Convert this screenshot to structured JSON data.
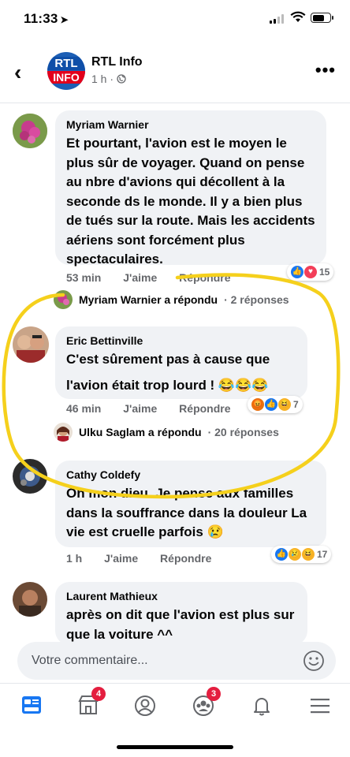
{
  "status_bar": {
    "time": "11:33"
  },
  "header": {
    "logo_top": "RTL",
    "logo_bottom": "INFO",
    "page_name": "RTL Info",
    "meta": "1 h ·"
  },
  "comments": [
    {
      "author": "Myriam Warnier",
      "text": "Et pourtant, l'avion est le moyen le plus sûr de voyager. Quand on pense au nbre d'avions qui décollent à la seconde ds le monde. Il y a bien plus de tués sur la route. Mais les accidents aériens sont forcément plus spectaculaires.",
      "time": "53 min",
      "like": "J'aime",
      "reply": "Répondre",
      "reaction_count": "15",
      "replies": {
        "who": "Myriam Warnier a répondu",
        "count": "· 2 réponses"
      }
    },
    {
      "author": "Eric Bettinville",
      "text_line1": "C'est sûrement pas à cause que",
      "text_line2": "l'avion était trop lourd ! 😂😂😂",
      "time": "46 min",
      "like": "J'aime",
      "reply": "Répondre",
      "reaction_count": "7",
      "replies": {
        "who": "Ulku Saglam a répondu",
        "count": "· 20 réponses"
      }
    },
    {
      "author": "Cathy Coldefy",
      "text": "Oh mon dieu.  Je pense aux familles dans la souffrance dans la douleur La vie est cruelle parfois 😢",
      "time": "1 h",
      "like": "J'aime",
      "reply": "Répondre",
      "reaction_count": "17"
    },
    {
      "author": "Laurent Mathieux",
      "text": "après on dit que l'avion est plus sur que la voiture ^^"
    }
  ],
  "composer": {
    "placeholder": "Votre commentaire..."
  },
  "tabbar": {
    "tabs": [
      {
        "icon": "news-feed-icon"
      },
      {
        "icon": "marketplace-icon",
        "badge": "4"
      },
      {
        "icon": "profile-icon"
      },
      {
        "icon": "groups-icon",
        "badge": "3"
      },
      {
        "icon": "bell-icon"
      },
      {
        "icon": "menu-icon"
      }
    ]
  },
  "colors": {
    "accent": "#1877f2",
    "bubble": "#f0f2f5",
    "highlight": "#f5d01c",
    "badge": "#e41e3f"
  }
}
